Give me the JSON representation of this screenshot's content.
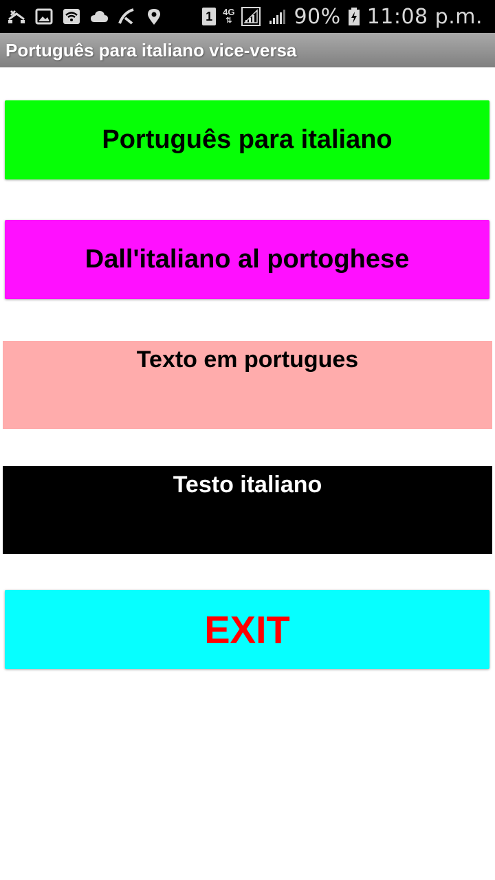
{
  "status_bar": {
    "left_icons": [
      "missed-call-icon",
      "image-icon",
      "wifi-icon",
      "cloud-icon",
      "app-icon",
      "location-icon"
    ],
    "sim_slot": "1",
    "network_type": "4G",
    "battery_percent": "90%",
    "time": "11:08 p.m."
  },
  "app_bar": {
    "title": "Português para italiano vice-versa"
  },
  "buttons": {
    "pt_to_it": "Português para italiano",
    "it_to_pt": "Dall'italiano al portoghese",
    "exit": "EXIT"
  },
  "text_areas": {
    "portuguese_label": "Texto em portugues",
    "italian_label": "Testo italiano"
  },
  "colors": {
    "pt_to_it_bg": "#06ff06",
    "it_to_pt_bg": "#ff10ff",
    "portuguese_box_bg": "#ffacac",
    "italian_box_bg": "#000000",
    "exit_bg": "#06ffff",
    "exit_text": "#ff0000"
  }
}
